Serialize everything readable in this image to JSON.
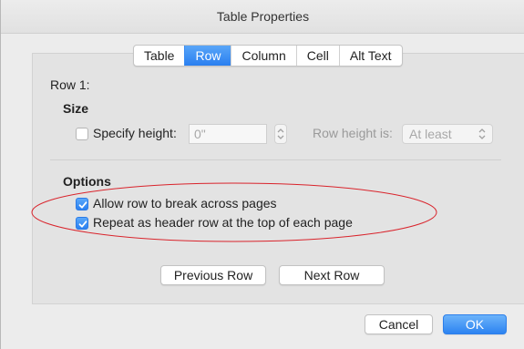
{
  "window": {
    "title": "Table Properties"
  },
  "tabs": [
    {
      "label": "Table",
      "active": false
    },
    {
      "label": "Row",
      "active": true
    },
    {
      "label": "Column",
      "active": false
    },
    {
      "label": "Cell",
      "active": false
    },
    {
      "label": "Alt Text",
      "active": false
    }
  ],
  "row_panel": {
    "row_label": "Row 1:",
    "size": {
      "heading": "Size",
      "specify_height_label": "Specify height:",
      "specify_height_checked": false,
      "height_value": "0\"",
      "row_height_is_label": "Row height is:",
      "row_height_is_value": "At least"
    },
    "options": {
      "heading": "Options",
      "allow_break_label": "Allow row to break across pages",
      "allow_break_checked": true,
      "repeat_header_label": "Repeat as header row at the top of each page",
      "repeat_header_checked": true
    },
    "previous_row_label": "Previous Row",
    "next_row_label": "Next Row"
  },
  "footer": {
    "cancel_label": "Cancel",
    "ok_label": "OK"
  },
  "colors": {
    "accent": "#2a7ff0",
    "annotation": "#d9232b"
  }
}
